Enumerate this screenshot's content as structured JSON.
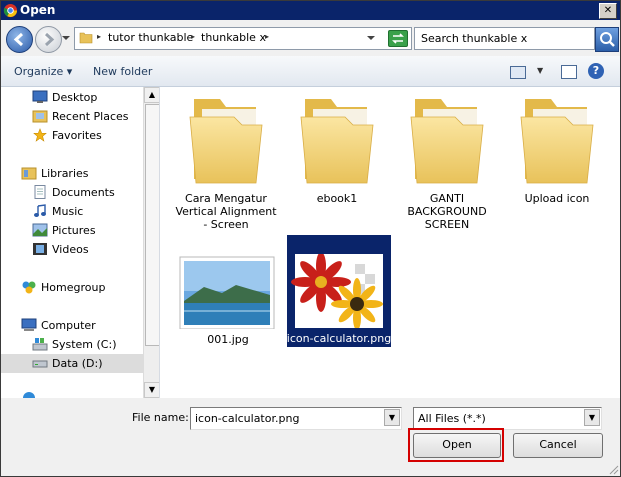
{
  "window": {
    "title": "Open"
  },
  "address": {
    "crumbs": [
      "tutor thunkable",
      "thunkable x"
    ]
  },
  "search": {
    "placeholder": "Search thunkable x"
  },
  "toolbar": {
    "organize": "Organize",
    "new_folder": "New folder"
  },
  "nav_items": [
    {
      "label": "Desktop",
      "icon": "desktop-icon"
    },
    {
      "label": "Recent Places",
      "icon": "recent-places-icon"
    },
    {
      "label": "Favorites",
      "icon": "star-icon"
    },
    {
      "label": "Libraries",
      "icon": "libraries-icon"
    },
    {
      "label": "Documents",
      "icon": "documents-icon"
    },
    {
      "label": "Music",
      "icon": "music-icon"
    },
    {
      "label": "Pictures",
      "icon": "pictures-icon"
    },
    {
      "label": "Videos",
      "icon": "videos-icon"
    },
    {
      "label": "Homegroup",
      "icon": "homegroup-icon"
    },
    {
      "label": "Computer",
      "icon": "computer-icon"
    },
    {
      "label": "System (C:)",
      "icon": "drive-c-icon"
    },
    {
      "label": "Data (D:)",
      "icon": "drive-d-icon"
    }
  ],
  "files": [
    {
      "name": "Cara Mengatur Vertical Alignment - Screen",
      "type": "folder"
    },
    {
      "name": "ebook1",
      "type": "folder"
    },
    {
      "name": "GANTI BACKGROUND SCREEN",
      "type": "folder"
    },
    {
      "name": "Upload icon",
      "type": "folder"
    },
    {
      "name": "001.jpg",
      "type": "image"
    },
    {
      "name": "icon-calculator.png",
      "type": "image",
      "selected": true
    }
  ],
  "bottom": {
    "file_name_label": "File name:",
    "file_name_value": "icon-calculator.png",
    "file_type_value": "All Files (*.*)",
    "open_label": "Open",
    "cancel_label": "Cancel"
  },
  "colors": {
    "selection": "#0a246a",
    "highlight_border": "#d40000",
    "titlebar": "#0a246a"
  }
}
